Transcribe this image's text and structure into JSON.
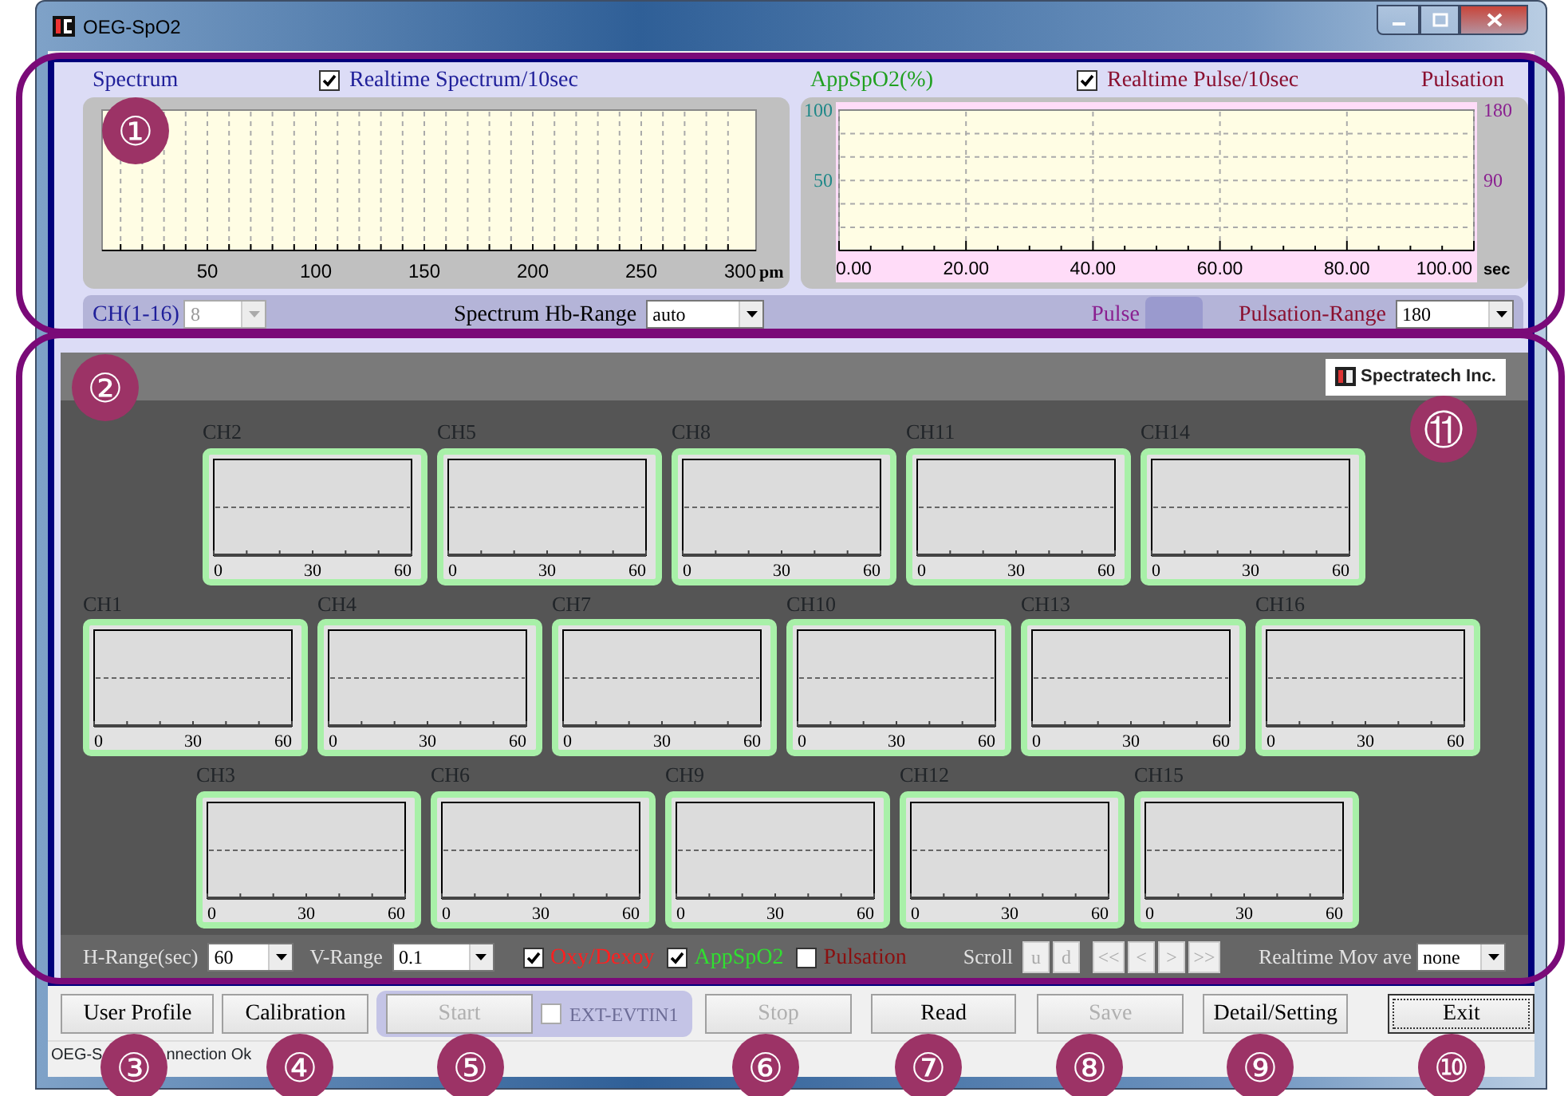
{
  "window": {
    "title": "OEG-SpO2"
  },
  "spectrum": {
    "title": "Spectrum",
    "realtime": {
      "label": "Realtime Spectrum/10sec",
      "checked": true
    },
    "x_tick_labels": [
      "50",
      "100",
      "150",
      "200",
      "250",
      "300"
    ],
    "x_unit": "pm"
  },
  "pulse": {
    "title": "AppSpO2(%)",
    "realtime": {
      "label": "Realtime Pulse/10sec",
      "checked": true
    },
    "right_title": "Pulsation",
    "right_axis_labels": [
      "180",
      "90"
    ],
    "left_axis_labels": [
      "100",
      "50"
    ],
    "x_tick_labels": [
      "0.00",
      "20.00",
      "40.00",
      "60.00",
      "80.00",
      "100.00"
    ],
    "x_unit": "sec"
  },
  "range_bar": {
    "channel": {
      "label": "CH(1-16)",
      "value": "8",
      "disabled": true
    },
    "hb_range": {
      "label": "Spectrum Hb-Range",
      "value": "auto",
      "disabled": false
    },
    "pulse_label": "Pulse",
    "pulsation_range": {
      "label": "Pulsation-Range",
      "value": "180",
      "disabled": false
    }
  },
  "monitor": {
    "logo_text": "Spectratech Inc.",
    "channel_rows": [
      [
        {
          "name": "CH2",
          "x_tick_labels": [
            "0",
            "30",
            "60"
          ]
        },
        {
          "name": "CH5",
          "x_tick_labels": [
            "0",
            "30",
            "60"
          ]
        },
        {
          "name": "CH8",
          "x_tick_labels": [
            "0",
            "30",
            "60"
          ]
        },
        {
          "name": "CH11",
          "x_tick_labels": [
            "0",
            "30",
            "60"
          ]
        },
        {
          "name": "CH14",
          "x_tick_labels": [
            "0",
            "30",
            "60"
          ]
        }
      ],
      [
        {
          "name": "CH1",
          "x_tick_labels": [
            "0",
            "30",
            "60"
          ]
        },
        {
          "name": "CH4",
          "x_tick_labels": [
            "0",
            "30",
            "60"
          ]
        },
        {
          "name": "CH7",
          "x_tick_labels": [
            "0",
            "30",
            "60"
          ]
        },
        {
          "name": "CH10",
          "x_tick_labels": [
            "0",
            "30",
            "60"
          ]
        },
        {
          "name": "CH13",
          "x_tick_labels": [
            "0",
            "30",
            "60"
          ]
        },
        {
          "name": "CH16",
          "x_tick_labels": [
            "0",
            "30",
            "60"
          ]
        }
      ],
      [
        {
          "name": "CH3",
          "x_tick_labels": [
            "0",
            "30",
            "60"
          ]
        },
        {
          "name": "CH6",
          "x_tick_labels": [
            "0",
            "30",
            "60"
          ]
        },
        {
          "name": "CH9",
          "x_tick_labels": [
            "0",
            "30",
            "60"
          ]
        },
        {
          "name": "CH12",
          "x_tick_labels": [
            "0",
            "30",
            "60"
          ]
        },
        {
          "name": "CH15",
          "x_tick_labels": [
            "0",
            "30",
            "60"
          ]
        }
      ]
    ],
    "controls": {
      "h_range": {
        "label": "H-Range(sec)",
        "value": "60",
        "disabled": false
      },
      "v_range": {
        "label": "V-Range",
        "value": "0.1",
        "disabled": false
      },
      "toggles": [
        {
          "label": "Oxy/Dexoy",
          "checked": true,
          "color": "#ff2020"
        },
        {
          "label": "AppSpO2",
          "checked": true,
          "color": "#30e030"
        },
        {
          "label": "Pulsation",
          "checked": false,
          "color": "#8a1010"
        }
      ],
      "scroll": {
        "label": "Scroll",
        "buttons": [
          {
            "label": "u",
            "disabled": true
          },
          {
            "label": "d",
            "disabled": true
          },
          {
            "label": "<<",
            "disabled": true
          },
          {
            "label": "<",
            "disabled": true
          },
          {
            "label": ">",
            "disabled": true
          },
          {
            "label": ">>",
            "disabled": true
          }
        ]
      },
      "mov_ave": {
        "label": "Realtime Mov ave",
        "value": "none",
        "disabled": false
      }
    }
  },
  "buttons": [
    {
      "kind": "button",
      "label": "User Profile",
      "disabled": false,
      "focused": false
    },
    {
      "kind": "button",
      "label": "Calibration",
      "disabled": false,
      "focused": false
    },
    {
      "kind": "trigger-group",
      "button": {
        "label": "Start",
        "disabled": true,
        "focused": false
      },
      "checkbox": {
        "label": "EXT-EVTIN1",
        "checked": false,
        "disabled": true
      }
    },
    {
      "kind": "button",
      "label": "Stop",
      "disabled": true,
      "focused": false
    },
    {
      "kind": "button",
      "label": "Read",
      "disabled": false,
      "focused": false
    },
    {
      "kind": "button",
      "label": "Save",
      "disabled": true,
      "focused": false
    },
    {
      "kind": "button",
      "label": "Detail/Setting",
      "disabled": false,
      "focused": false
    },
    {
      "kind": "button",
      "label": "Exit",
      "disabled": false,
      "focused": true
    }
  ],
  "status_bar": {
    "parts": [
      "OEG-S",
      "nnection Ok"
    ]
  },
  "callouts": [
    "①",
    "②",
    "③",
    "④",
    "⑤",
    "⑥",
    "⑦",
    "⑧",
    "⑨",
    "⑩",
    "⑪"
  ]
}
